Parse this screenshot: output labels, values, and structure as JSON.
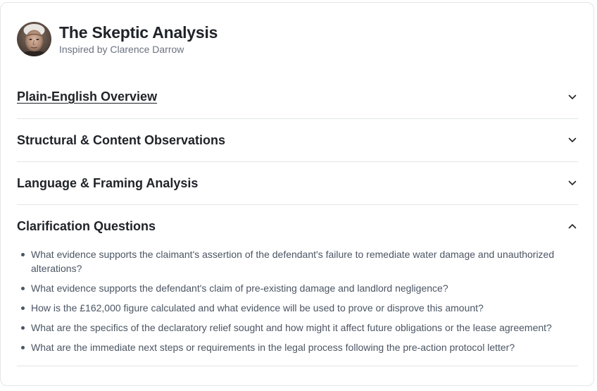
{
  "header": {
    "title": "The Skeptic Analysis",
    "subtitle": "Inspired by Clarence Darrow",
    "avatar_icon": "portrait-avatar"
  },
  "sections": [
    {
      "title": "Plain-English Overview",
      "state": "collapsed",
      "icon": "chevron-down-icon"
    },
    {
      "title": "Structural & Content Observations",
      "state": "collapsed",
      "icon": "chevron-down-icon"
    },
    {
      "title": "Language & Framing Analysis",
      "state": "collapsed",
      "icon": "chevron-down-icon"
    },
    {
      "title": "Clarification Questions",
      "state": "expanded",
      "icon": "chevron-up-icon",
      "items": [
        "What evidence supports the claimant's assertion of the defendant's failure to remediate water damage and unauthorized alterations?",
        "What evidence supports the defendant's claim of pre-existing damage and landlord negligence?",
        "How is the £162,000 figure calculated and what evidence will be used to prove or disprove this amount?",
        "What are the specifics of the declaratory relief sought and how might it affect future obligations or the lease agreement?",
        "What are the immediate next steps or requirements in the legal process following the pre-action protocol letter?"
      ]
    }
  ],
  "colors": {
    "text_primary": "#1f2328",
    "text_secondary": "#6b7280",
    "divider": "#e3e5e8"
  }
}
